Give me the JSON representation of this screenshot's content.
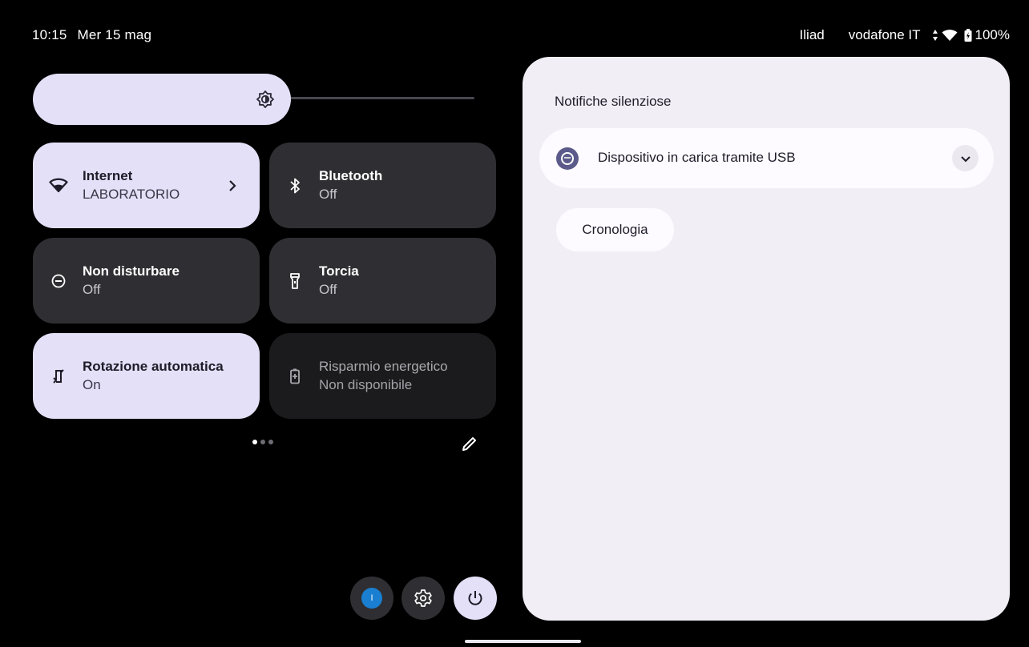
{
  "status_bar": {
    "time": "10:15",
    "date": "Mer 15 mag",
    "carrier1": "Iliad",
    "carrier2": "vodafone IT",
    "battery": "100%"
  },
  "brightness": {
    "icon": "brightness-icon"
  },
  "tiles": [
    {
      "label": "Internet",
      "sub": "LABORATORIO",
      "state": "on",
      "icon": "wifi-icon"
    },
    {
      "label": "Bluetooth",
      "sub": "Off",
      "state": "off",
      "icon": "bluetooth-icon"
    },
    {
      "label": "Non disturbare",
      "sub": "Off",
      "state": "off",
      "icon": "dnd-icon"
    },
    {
      "label": "Torcia",
      "sub": "Off",
      "state": "off",
      "icon": "flashlight-icon"
    },
    {
      "label": "Rotazione automatica",
      "sub": "On",
      "state": "on",
      "icon": "rotate-icon"
    },
    {
      "label": "Risparmio energetico",
      "sub": "Non disponibile",
      "state": "disabled",
      "icon": "battery-saver-icon"
    }
  ],
  "user_badge": "I",
  "notifications": {
    "section_title": "Notifiche silenziose",
    "items": [
      {
        "text": "Dispositivo in carica tramite USB",
        "icon": "usb-charging-icon"
      }
    ],
    "history_label": "Cronologia"
  },
  "colors": {
    "accent": "#e4e0f8",
    "tile_off": "#2f2f33",
    "panel": "#f1eef5"
  }
}
